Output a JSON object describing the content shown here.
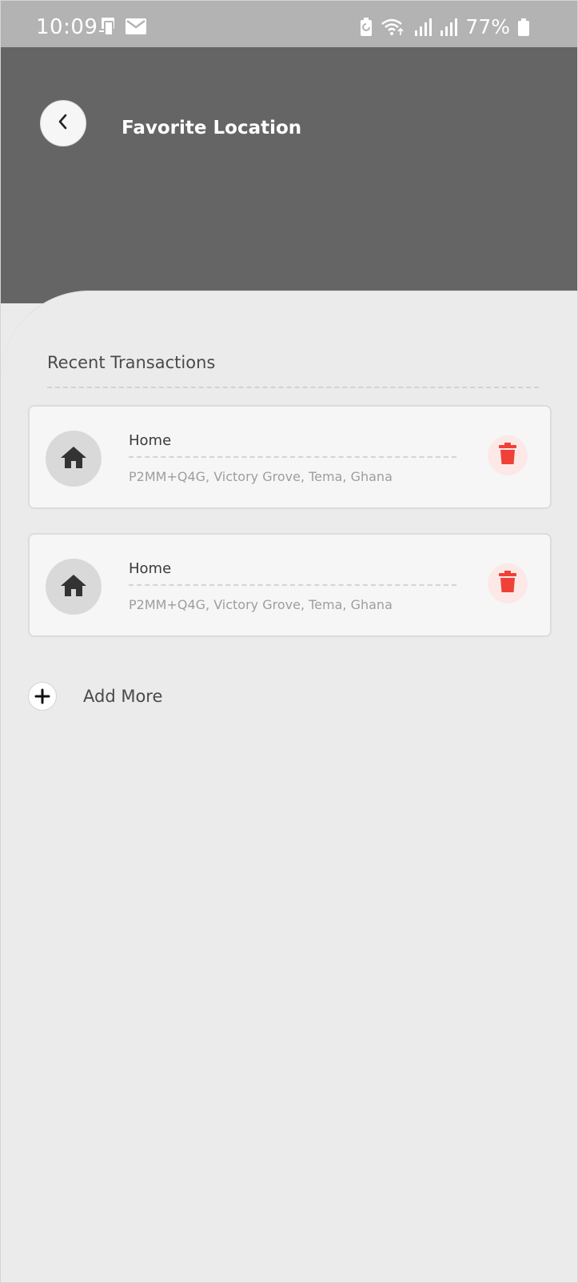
{
  "status_bar": {
    "time": "10:09",
    "battery_percent": "77%",
    "icons_left": [
      "screen-mirror-icon",
      "mail-icon"
    ],
    "icons_right": [
      "battery-saver-icon",
      "wifi-icon",
      "signal-icon",
      "signal-icon",
      "battery-icon"
    ]
  },
  "header": {
    "title": "Favorite Location",
    "back_icon": "chevron-left-icon"
  },
  "section": {
    "title": "Recent Transactions"
  },
  "locations": [
    {
      "name": "Home",
      "address": "P2MM+Q4G, Victory Grove, Tema, Ghana",
      "icon": "home-icon",
      "delete_icon": "trash-icon"
    },
    {
      "name": "Home",
      "address": "P2MM+Q4G, Victory Grove, Tema, Ghana",
      "icon": "home-icon",
      "delete_icon": "trash-icon"
    }
  ],
  "add_more": {
    "label": "Add More",
    "icon": "plus-icon"
  },
  "colors": {
    "status_bar": "#b3b3b3",
    "header": "#656565",
    "background": "#ebebeb",
    "card": "#f6f6f6",
    "delete_accent": "#ef4136",
    "delete_bg": "#fde8e8"
  }
}
